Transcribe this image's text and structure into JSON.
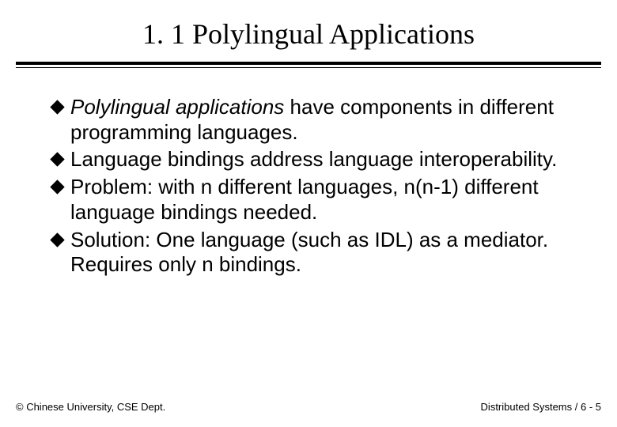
{
  "title": "1. 1 Polylingual Applications",
  "bullets": [
    {
      "emph": "Polylingual applications",
      "rest": " have components in different programming languages."
    },
    {
      "emph": "",
      "rest": "Language bindings address language interoperability."
    },
    {
      "emph": "",
      "rest": "Problem: with n different languages, n(n-1) different language bindings needed."
    },
    {
      "emph": "",
      "rest": "Solution: One language (such as IDL) as a mediator. Requires only n bindings."
    }
  ],
  "footer": {
    "left": "© Chinese University, CSE Dept.",
    "right": "Distributed Systems / 6 - 5"
  }
}
